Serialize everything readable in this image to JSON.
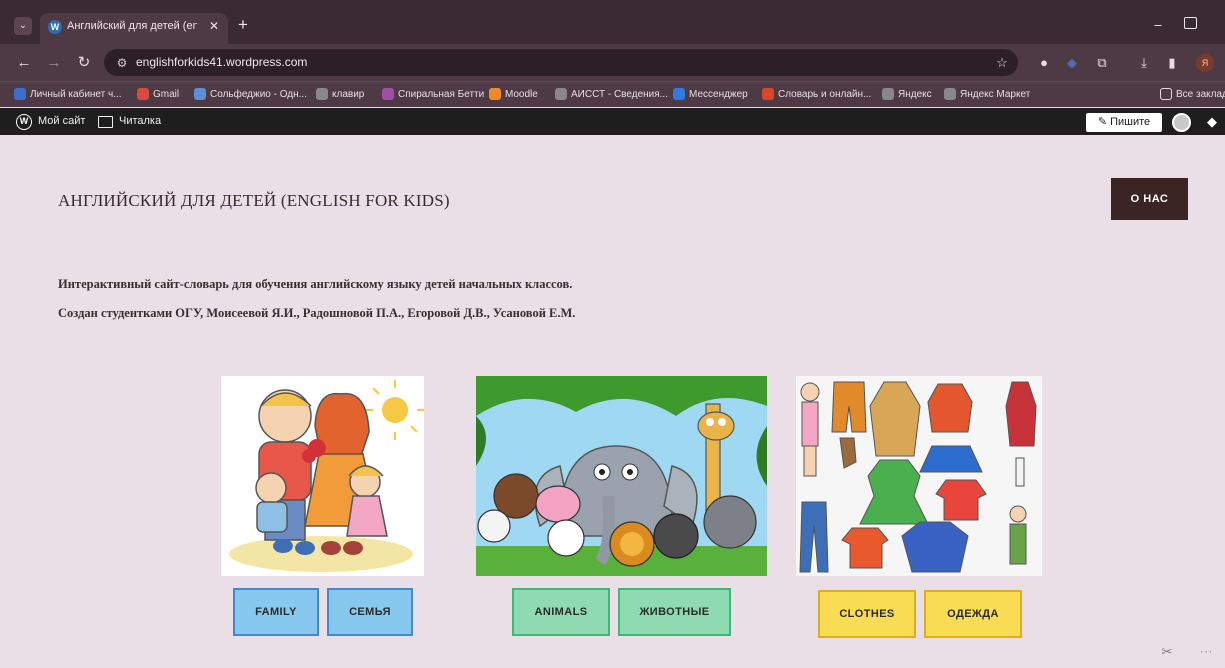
{
  "browser": {
    "tab_title": "Английский для детей (english",
    "tab_close": "✕",
    "new_tab": "+",
    "url": "englishforkids41.wordpress.com",
    "profile_initial": "Я",
    "bookmarks": [
      {
        "label": "Личный кабинет ч...",
        "icon": "cabinet-icon",
        "color": "#3a6fd0"
      },
      {
        "label": "Gmail",
        "icon": "gmail-icon",
        "color": "#d94b3d"
      },
      {
        "label": "Сольфеджио - Одн...",
        "icon": "solfeggio-icon",
        "color": "#5c8fd6"
      },
      {
        "label": "клавир",
        "icon": "globe-icon",
        "color": "#888888"
      },
      {
        "label": "Спиральная Бетти",
        "icon": "spiral-icon",
        "color": "#a04ea8"
      },
      {
        "label": "Moodle",
        "icon": "moodle-icon",
        "color": "#f08a24"
      },
      {
        "label": "АИССТ - Сведения...",
        "icon": "globe-icon",
        "color": "#888888"
      },
      {
        "label": "Мессенджер",
        "icon": "messenger-icon",
        "color": "#2f7be6"
      },
      {
        "label": "Словарь и онлайн...",
        "icon": "dictionary-icon",
        "color": "#d8452c"
      },
      {
        "label": "Яндекс",
        "icon": "globe-icon",
        "color": "#888888"
      },
      {
        "label": "Яндекс Маркет",
        "icon": "globe-icon",
        "color": "#888888"
      }
    ],
    "all_bookmarks": "Все заклад"
  },
  "wp_admin": {
    "my_site": "Мой сайт",
    "reader": "Читалка",
    "write": "Пишите"
  },
  "site": {
    "title": "АНГЛИЙСКИЙ ДЛЯ ДЕТЕЙ (ENGLISH FOR KIDS)",
    "about_button": "О НАС",
    "intro_line1": "Интерактивный сайт-словарь для обучения английскому языку детей начальных классов.",
    "intro_line2": "Создан студентками ОГУ, Моисеевой Я.И., Радошновой П.А., Егоровой Д.В., Усановой Е.М."
  },
  "tiles": [
    {
      "en": "FAMILY",
      "ru": "СЕМЬЯ"
    },
    {
      "en": "ANIMALS",
      "ru": "ЖИВОТНЫЕ"
    },
    {
      "en": "CLOTHES",
      "ru": "ОДЕЖДА"
    }
  ],
  "colors": {
    "page_bg": "#eadfe6",
    "about_bg": "#3a2424",
    "blue": "#87c8ef",
    "green": "#8edbb1",
    "yellow": "#f8dc53"
  }
}
